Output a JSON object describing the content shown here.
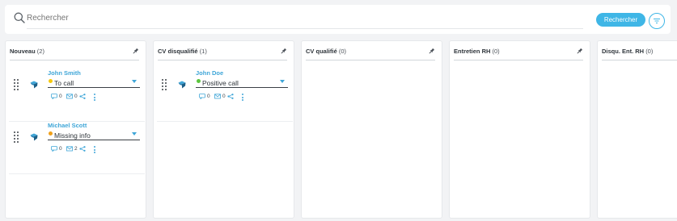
{
  "search": {
    "placeholder": "Rechercher",
    "button_label": "Rechercher",
    "icon": "search-icon",
    "filter_icon": "filter-icon"
  },
  "colors": {
    "accent": "#3fb6e6",
    "status_yellow": "#f6c90e",
    "status_green": "#5cc63f",
    "status_orange": "#f0a01a"
  },
  "columns": [
    {
      "title": "Nouveau",
      "count": "(2)",
      "cards": [
        {
          "name": "John Smith",
          "status": "To call",
          "status_color": "yellow",
          "comments": "0",
          "emails": "0"
        },
        {
          "name": "Michael Scott",
          "status": "Missing info",
          "status_color": "orange",
          "comments": "0",
          "emails": "2"
        }
      ]
    },
    {
      "title": "CV disqualifié",
      "count": "(1)",
      "cards": [
        {
          "name": "John Doe",
          "status": "Positive call",
          "status_color": "green",
          "comments": "0",
          "emails": "0"
        }
      ]
    },
    {
      "title": "CV qualifié",
      "count": "(0)",
      "cards": []
    },
    {
      "title": "Entretien RH",
      "count": "(0)",
      "cards": []
    },
    {
      "title": "Disqu. Ent. RH",
      "count": "(0)",
      "cards": []
    }
  ]
}
